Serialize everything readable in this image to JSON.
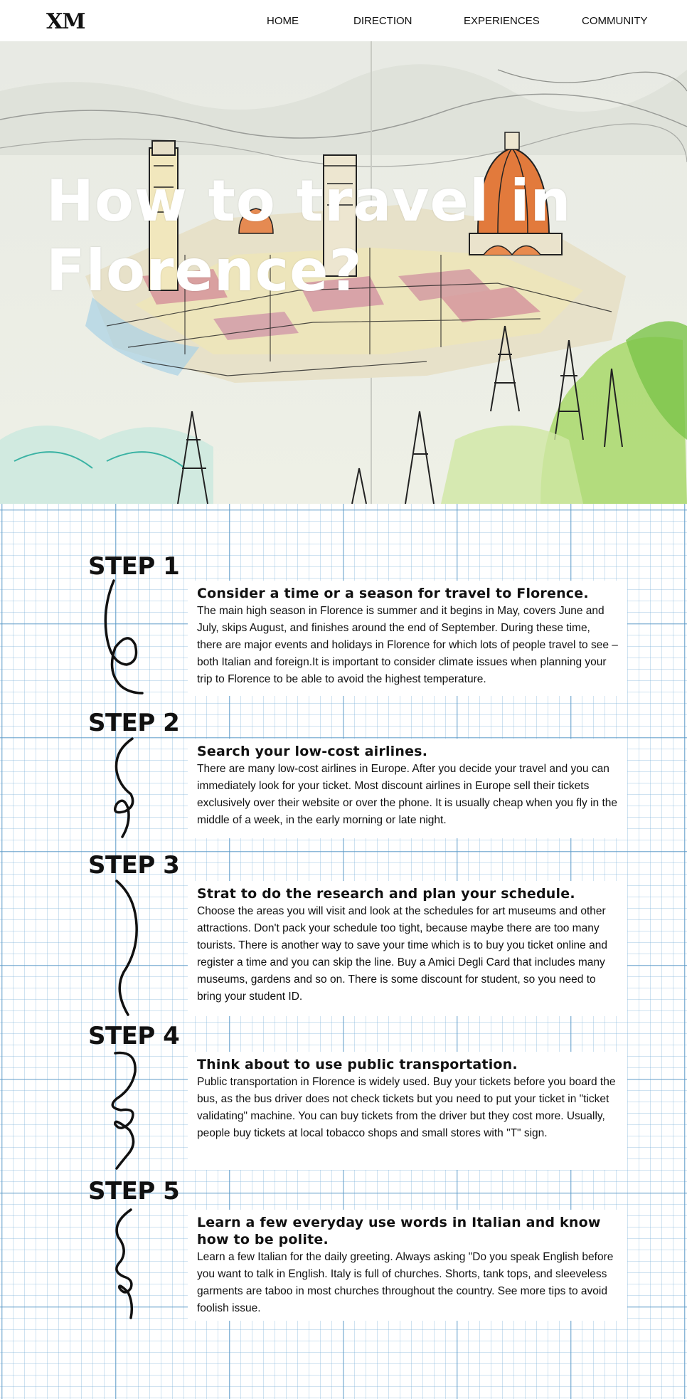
{
  "nav": {
    "logo": "XM",
    "items": [
      "HOME",
      "DIRECTION",
      "EXPERIENCES",
      "COMMUNITY"
    ]
  },
  "hero": {
    "title": "How to travel in Florence?",
    "image": "Florence cityscape sketch with cathedral dome"
  },
  "colors": {
    "grid_line": "#5696c4",
    "dome": "#e27a3c",
    "tree_green": "#7cc44a",
    "text": "#111111"
  },
  "steps": [
    {
      "label": "STEP 1",
      "title": "Consider a time or a season for travel to Florence.",
      "body": "The main high season in Florence is summer and it begins in May, covers June and July, skips August, and finishes around the end of September. During these time, there are major events and holidays in Florence for which lots of people travel to see – both Italian and foreign.It is important to consider climate issues when planning your trip to Florence to be able to avoid the highest temperature."
    },
    {
      "label": "STEP 2",
      "title": "Search your low-cost airlines.",
      "body": "There are many low-cost airlines in Europe. After you decide your travel and you can immediately look for your ticket. Most discount airlines in Europe sell their tickets exclusively over their website or over the phone. It is usually cheap when you fly in the middle of a week, in the early morning or late night."
    },
    {
      "label": "STEP 3",
      "title": "Strat to do the research and plan your schedule.",
      "body": "Choose the areas you will visit and look at the schedules for art museums and other attractions. Don't pack your schedule too tight, because maybe there are too many tourists. There is another way to save your time which is to buy you ticket online and register a time and you can skip the line. Buy a Amici Degli Card that includes many museums, gardens and so on. There is some discount for student, so you need to bring your student ID."
    },
    {
      "label": "STEP 4",
      "title": "Think about to use public transportation.",
      "body": "Public transportation in Florence is widely used. Buy your tickets before you board the bus, as the bus driver does not check tickets but you need to put your ticket in \"ticket validating\" machine. You can buy tickets from the driver but they cost more. Usually, people buy tickets at local tobacco shops and small stores with \"T\" sign."
    },
    {
      "label": "STEP 5",
      "title": "Learn a few everyday use words in Italian and know how to be polite.",
      "body": "Learn a few Italian for the daily greeting. Always asking \"Do you speak English before you want to talk in English. Italy is full of churches. Shorts, tank tops, and sleeveless garments are taboo in most churches throughout the country. See more tips to avoid foolish issue."
    }
  ]
}
